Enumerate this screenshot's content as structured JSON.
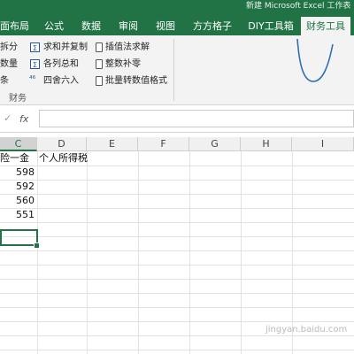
{
  "title_bar": {
    "title": "新建 Microsoft Excel 工作表"
  },
  "tabs": [
    {
      "label": "面布局"
    },
    {
      "label": "公式"
    },
    {
      "label": "数据"
    },
    {
      "label": "审阅"
    },
    {
      "label": "视图"
    },
    {
      "label": "方方格子"
    },
    {
      "label": "DIY工具箱"
    },
    {
      "label": "财务工具",
      "active": true
    }
  ],
  "ribbon": {
    "left_col": [
      "拆分",
      "数量",
      "条"
    ],
    "group1": {
      "items": [
        "求和并复制",
        "各列总和",
        "四舍六入"
      ],
      "icons": [
        "sum-icon",
        "sum-icon",
        "round-icon"
      ]
    },
    "group2": {
      "items": [
        "插值法求解",
        "整数补零",
        "批量转数值格式"
      ],
      "icons": [
        "document-icon",
        "document-icon",
        "document-icon"
      ]
    },
    "group_label": "财务",
    "accent": "#217346"
  },
  "formula_bar": {
    "fx": "fx",
    "value": ""
  },
  "columns": [
    "C",
    "D",
    "E",
    "F",
    "G",
    "H",
    "I"
  ],
  "rows": [
    {
      "c": "险一金",
      "d": "个人所得税"
    },
    {
      "c": "598"
    },
    {
      "c": "592"
    },
    {
      "c": "560"
    },
    {
      "c": "551"
    }
  ],
  "watermark": "jingyan.baidu.com"
}
